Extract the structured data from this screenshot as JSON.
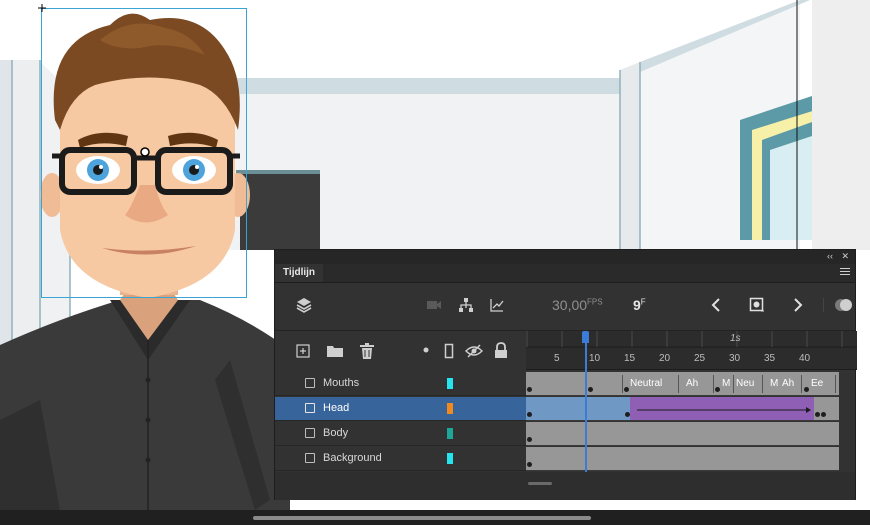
{
  "panel": {
    "tab_label": "Tijdlijn",
    "collapse_glyph": "‹‹",
    "close_glyph": "✕",
    "fps_value": "30,00",
    "fps_unit": "FPS",
    "frame_value": "9",
    "frame_unit": "F",
    "ruler": {
      "second_label": "1s",
      "ticks": [
        "5",
        "10",
        "15",
        "20",
        "25",
        "30",
        "35",
        "40"
      ]
    },
    "layers": [
      {
        "name": "Mouths",
        "color": "#27e3ee",
        "selected": false
      },
      {
        "name": "Head",
        "color": "#f08a1e",
        "selected": true
      },
      {
        "name": "Body",
        "color": "#1fa69a",
        "selected": false
      },
      {
        "name": "Background",
        "color": "#27e3ee",
        "selected": false
      }
    ],
    "mouth_labels": [
      "Neutral",
      "Ah",
      "M",
      "Neu",
      "M",
      "Ah",
      "Ee"
    ]
  },
  "icons": {
    "layers": "layers-icon",
    "camera": "camera-icon",
    "hierarchy": "hierarchy-icon",
    "graph": "graph-icon",
    "prev": "chevron-left-icon",
    "insert_kf": "insert-keyframe-icon",
    "next": "chevron-right-icon",
    "onion": "onion-skin-icon",
    "new_layer": "new-layer-icon",
    "folder": "folder-icon",
    "trash": "trash-icon",
    "dot": "dot-icon",
    "outline": "outline-icon",
    "eye": "visibility-icon",
    "lock": "lock-icon"
  },
  "colors": {
    "selected_row": "#36649b",
    "tween": "#8e5fb5",
    "playhead": "#3d7bd9",
    "panel": "#323232"
  }
}
